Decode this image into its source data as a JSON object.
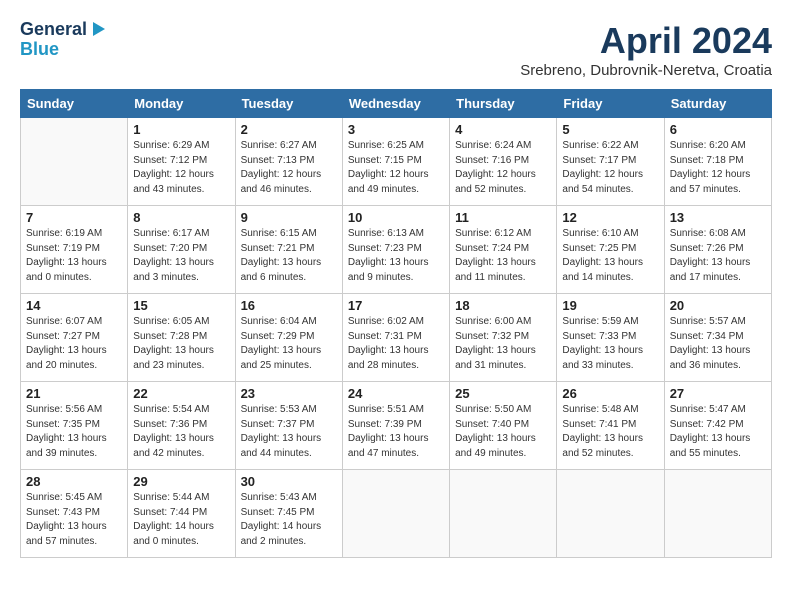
{
  "header": {
    "logo_line1": "General",
    "logo_line2": "Blue",
    "month_title": "April 2024",
    "location": "Srebreno, Dubrovnik-Neretva, Croatia"
  },
  "days_of_week": [
    "Sunday",
    "Monday",
    "Tuesday",
    "Wednesday",
    "Thursday",
    "Friday",
    "Saturday"
  ],
  "weeks": [
    [
      {
        "day": "",
        "info": ""
      },
      {
        "day": "1",
        "info": "Sunrise: 6:29 AM\nSunset: 7:12 PM\nDaylight: 12 hours\nand 43 minutes."
      },
      {
        "day": "2",
        "info": "Sunrise: 6:27 AM\nSunset: 7:13 PM\nDaylight: 12 hours\nand 46 minutes."
      },
      {
        "day": "3",
        "info": "Sunrise: 6:25 AM\nSunset: 7:15 PM\nDaylight: 12 hours\nand 49 minutes."
      },
      {
        "day": "4",
        "info": "Sunrise: 6:24 AM\nSunset: 7:16 PM\nDaylight: 12 hours\nand 52 minutes."
      },
      {
        "day": "5",
        "info": "Sunrise: 6:22 AM\nSunset: 7:17 PM\nDaylight: 12 hours\nand 54 minutes."
      },
      {
        "day": "6",
        "info": "Sunrise: 6:20 AM\nSunset: 7:18 PM\nDaylight: 12 hours\nand 57 minutes."
      }
    ],
    [
      {
        "day": "7",
        "info": "Sunrise: 6:19 AM\nSunset: 7:19 PM\nDaylight: 13 hours\nand 0 minutes."
      },
      {
        "day": "8",
        "info": "Sunrise: 6:17 AM\nSunset: 7:20 PM\nDaylight: 13 hours\nand 3 minutes."
      },
      {
        "day": "9",
        "info": "Sunrise: 6:15 AM\nSunset: 7:21 PM\nDaylight: 13 hours\nand 6 minutes."
      },
      {
        "day": "10",
        "info": "Sunrise: 6:13 AM\nSunset: 7:23 PM\nDaylight: 13 hours\nand 9 minutes."
      },
      {
        "day": "11",
        "info": "Sunrise: 6:12 AM\nSunset: 7:24 PM\nDaylight: 13 hours\nand 11 minutes."
      },
      {
        "day": "12",
        "info": "Sunrise: 6:10 AM\nSunset: 7:25 PM\nDaylight: 13 hours\nand 14 minutes."
      },
      {
        "day": "13",
        "info": "Sunrise: 6:08 AM\nSunset: 7:26 PM\nDaylight: 13 hours\nand 17 minutes."
      }
    ],
    [
      {
        "day": "14",
        "info": "Sunrise: 6:07 AM\nSunset: 7:27 PM\nDaylight: 13 hours\nand 20 minutes."
      },
      {
        "day": "15",
        "info": "Sunrise: 6:05 AM\nSunset: 7:28 PM\nDaylight: 13 hours\nand 23 minutes."
      },
      {
        "day": "16",
        "info": "Sunrise: 6:04 AM\nSunset: 7:29 PM\nDaylight: 13 hours\nand 25 minutes."
      },
      {
        "day": "17",
        "info": "Sunrise: 6:02 AM\nSunset: 7:31 PM\nDaylight: 13 hours\nand 28 minutes."
      },
      {
        "day": "18",
        "info": "Sunrise: 6:00 AM\nSunset: 7:32 PM\nDaylight: 13 hours\nand 31 minutes."
      },
      {
        "day": "19",
        "info": "Sunrise: 5:59 AM\nSunset: 7:33 PM\nDaylight: 13 hours\nand 33 minutes."
      },
      {
        "day": "20",
        "info": "Sunrise: 5:57 AM\nSunset: 7:34 PM\nDaylight: 13 hours\nand 36 minutes."
      }
    ],
    [
      {
        "day": "21",
        "info": "Sunrise: 5:56 AM\nSunset: 7:35 PM\nDaylight: 13 hours\nand 39 minutes."
      },
      {
        "day": "22",
        "info": "Sunrise: 5:54 AM\nSunset: 7:36 PM\nDaylight: 13 hours\nand 42 minutes."
      },
      {
        "day": "23",
        "info": "Sunrise: 5:53 AM\nSunset: 7:37 PM\nDaylight: 13 hours\nand 44 minutes."
      },
      {
        "day": "24",
        "info": "Sunrise: 5:51 AM\nSunset: 7:39 PM\nDaylight: 13 hours\nand 47 minutes."
      },
      {
        "day": "25",
        "info": "Sunrise: 5:50 AM\nSunset: 7:40 PM\nDaylight: 13 hours\nand 49 minutes."
      },
      {
        "day": "26",
        "info": "Sunrise: 5:48 AM\nSunset: 7:41 PM\nDaylight: 13 hours\nand 52 minutes."
      },
      {
        "day": "27",
        "info": "Sunrise: 5:47 AM\nSunset: 7:42 PM\nDaylight: 13 hours\nand 55 minutes."
      }
    ],
    [
      {
        "day": "28",
        "info": "Sunrise: 5:45 AM\nSunset: 7:43 PM\nDaylight: 13 hours\nand 57 minutes."
      },
      {
        "day": "29",
        "info": "Sunrise: 5:44 AM\nSunset: 7:44 PM\nDaylight: 14 hours\nand 0 minutes."
      },
      {
        "day": "30",
        "info": "Sunrise: 5:43 AM\nSunset: 7:45 PM\nDaylight: 14 hours\nand 2 minutes."
      },
      {
        "day": "",
        "info": ""
      },
      {
        "day": "",
        "info": ""
      },
      {
        "day": "",
        "info": ""
      },
      {
        "day": "",
        "info": ""
      }
    ]
  ]
}
